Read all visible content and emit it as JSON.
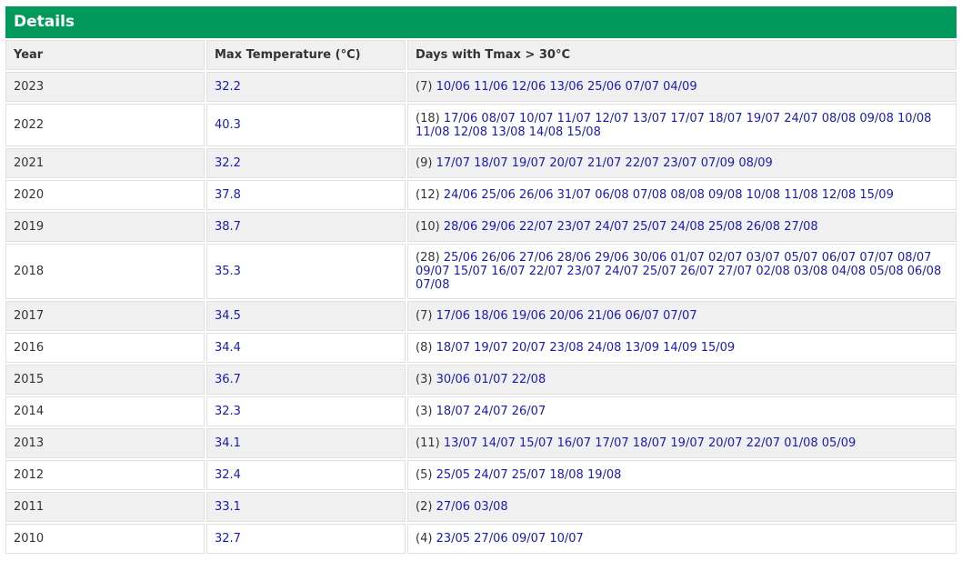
{
  "panel": {
    "title": "Details"
  },
  "colors": {
    "header_bg": "#019a5c",
    "link": "#1a1ab4",
    "row_alt": "#f0f0f0"
  },
  "table": {
    "headers": [
      "Year",
      "Max Temperature (°C)",
      "Days with Tmax > 30°C"
    ],
    "rows": [
      {
        "year": "2023",
        "max": "32.2",
        "count": "(7)",
        "dates": "10/06 11/06 12/06 13/06 25/06 07/07 04/09"
      },
      {
        "year": "2022",
        "max": "40.3",
        "count": "(18)",
        "dates": "17/06 08/07 10/07 11/07 12/07 13/07 17/07 18/07 19/07 24/07 08/08 09/08 10/08 11/08 12/08 13/08 14/08 15/08"
      },
      {
        "year": "2021",
        "max": "32.2",
        "count": "(9)",
        "dates": "17/07 18/07 19/07 20/07 21/07 22/07 23/07 07/09 08/09"
      },
      {
        "year": "2020",
        "max": "37.8",
        "count": "(12)",
        "dates": "24/06 25/06 26/06 31/07 06/08 07/08 08/08 09/08 10/08 11/08 12/08 15/09"
      },
      {
        "year": "2019",
        "max": "38.7",
        "count": "(10)",
        "dates": "28/06 29/06 22/07 23/07 24/07 25/07 24/08 25/08 26/08 27/08"
      },
      {
        "year": "2018",
        "max": "35.3",
        "count": "(28)",
        "dates": "25/06 26/06 27/06 28/06 29/06 30/06 01/07 02/07 03/07 05/07 06/07 07/07 08/07 09/07 15/07 16/07 22/07 23/07 24/07 25/07 26/07 27/07 02/08 03/08 04/08 05/08 06/08 07/08"
      },
      {
        "year": "2017",
        "max": "34.5",
        "count": "(7)",
        "dates": "17/06 18/06 19/06 20/06 21/06 06/07 07/07"
      },
      {
        "year": "2016",
        "max": "34.4",
        "count": "(8)",
        "dates": "18/07 19/07 20/07 23/08 24/08 13/09 14/09 15/09"
      },
      {
        "year": "2015",
        "max": "36.7",
        "count": "(3)",
        "dates": "30/06 01/07 22/08"
      },
      {
        "year": "2014",
        "max": "32.3",
        "count": "(3)",
        "dates": "18/07 24/07 26/07"
      },
      {
        "year": "2013",
        "max": "34.1",
        "count": "(11)",
        "dates": "13/07 14/07 15/07 16/07 17/07 18/07 19/07 20/07 22/07 01/08 05/09"
      },
      {
        "year": "2012",
        "max": "32.4",
        "count": "(5)",
        "dates": "25/05 24/07 25/07 18/08 19/08"
      },
      {
        "year": "2011",
        "max": "33.1",
        "count": "(2)",
        "dates": "27/06 03/08"
      },
      {
        "year": "2010",
        "max": "32.7",
        "count": "(4)",
        "dates": "23/05 27/06 09/07 10/07"
      }
    ]
  }
}
